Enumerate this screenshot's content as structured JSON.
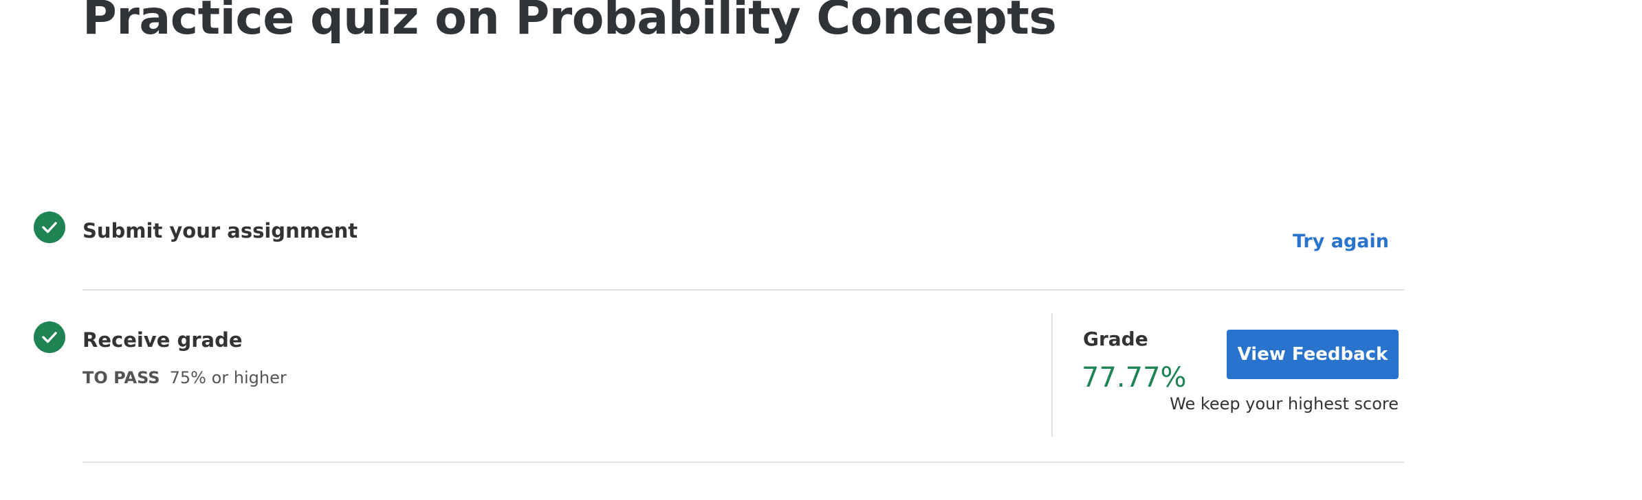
{
  "page": {
    "title": "Practice quiz on Probability Concepts"
  },
  "steps": [
    {
      "icon": "check-circle-icon",
      "title": "Submit your assignment",
      "action_label": "Try again"
    },
    {
      "icon": "check-circle-icon",
      "title": "Receive grade",
      "pass_label": "TO PASS",
      "pass_value": "75% or higher"
    }
  ],
  "grade": {
    "label": "Grade",
    "value": "77.77%",
    "button_label": "View Feedback",
    "note": "We keep your highest score"
  },
  "colors": {
    "success": "#1f8354",
    "link": "#2a73cc",
    "button_bg": "#2a73cc",
    "divider": "#dfe1e3"
  }
}
